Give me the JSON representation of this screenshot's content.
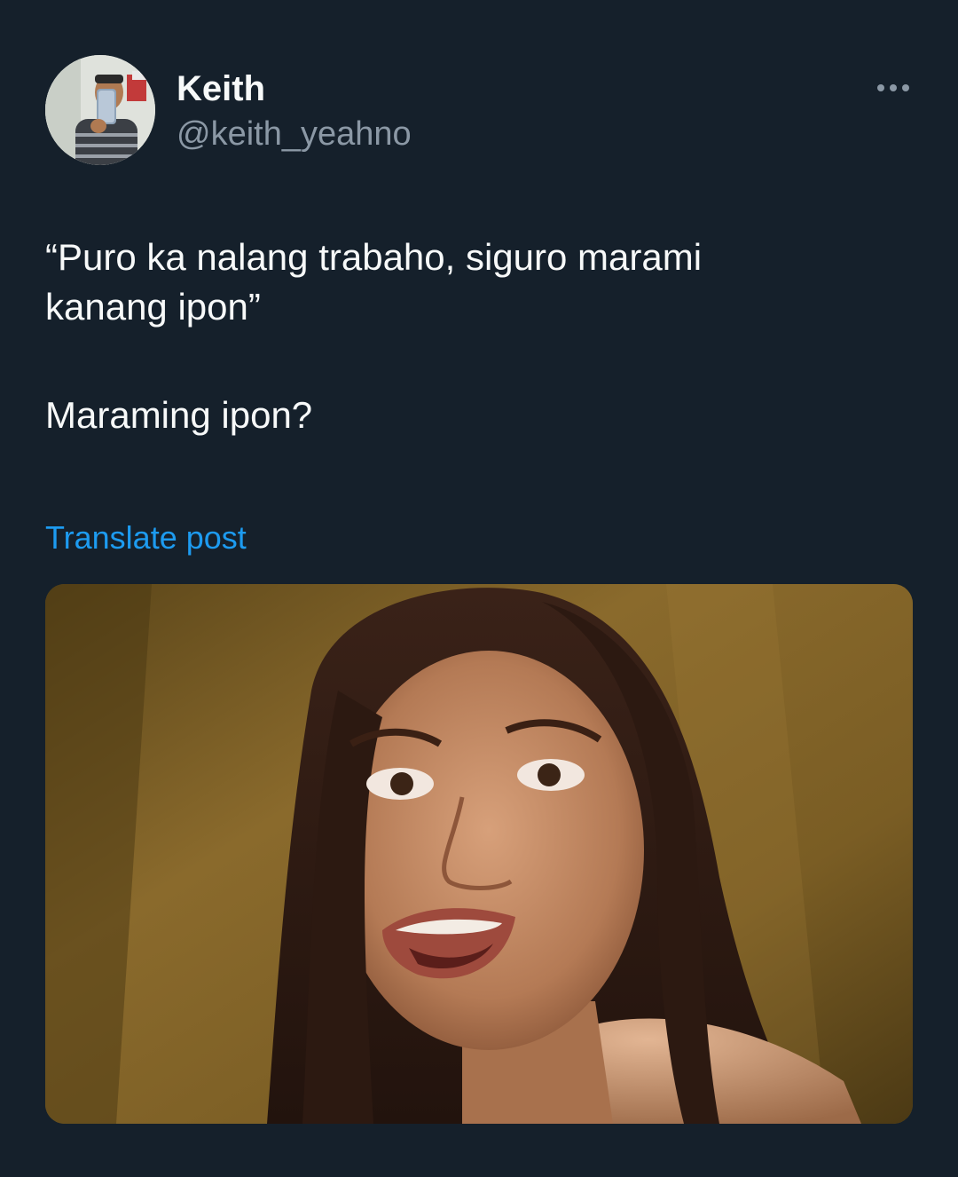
{
  "post": {
    "author": {
      "display_name": "Keith",
      "handle": "@keith_yeahno"
    },
    "text_line_1": "“Puro ka nalang trabaho, siguro marami kanang ipon”",
    "text_line_2": "Maraming ipon?",
    "translate_label": "Translate post",
    "more_icon": "ellipsis-icon"
  },
  "colors": {
    "background": "#15202b",
    "primary_text": "#f7f9f9",
    "secondary_text": "#8b98a5",
    "link": "#1d9bf0"
  }
}
